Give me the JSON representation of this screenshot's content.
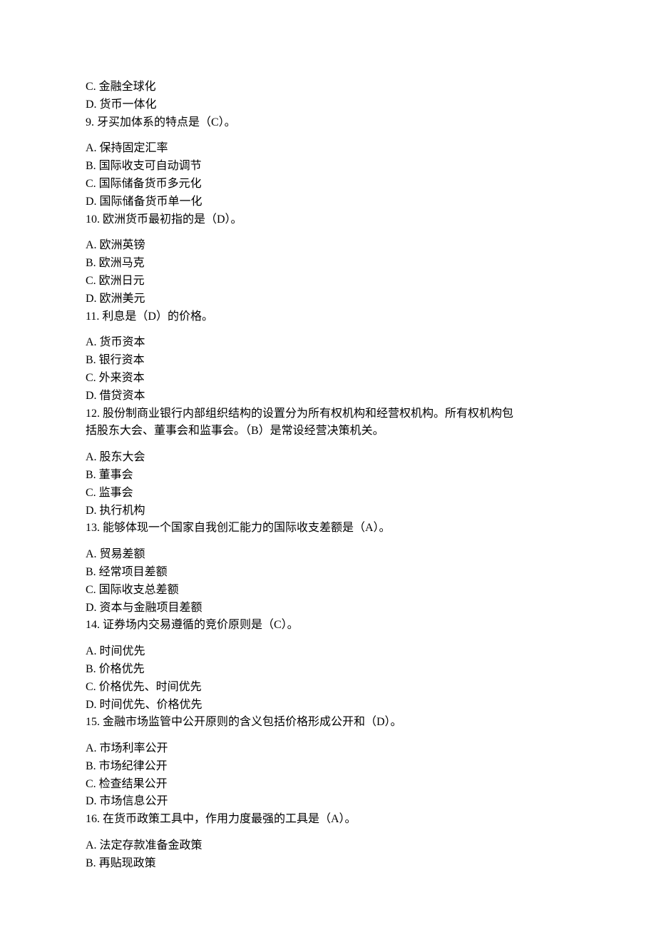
{
  "intro": {
    "optC": "C.  金融全球化",
    "optD": "D.  货币一体化"
  },
  "q9": {
    "stem": "9.      牙买加体系的特点是（C）。",
    "A": "A.  保持固定汇率",
    "B": "B.  国际收支可自动调节",
    "C": "C.  国际储备货币多元化",
    "D": "D.  国际储备货币单一化"
  },
  "q10": {
    "stem": "10.      欧洲货币最初指的是（D）。",
    "A": "A.  欧洲英镑",
    "B": "B.  欧洲马克",
    "C": "C.  欧洲日元",
    "D": "D.  欧洲美元"
  },
  "q11": {
    "stem": "11.      利息是（D）的价格。",
    "A": "A.  货币资本",
    "B": "B.  银行资本",
    "C": "C.  外来资本",
    "D": "D.  借贷资本"
  },
  "q12": {
    "stem1": "12.      股份制商业银行内部组织结构的设置分为所有权机构和经营权机构。所有权机构包",
    "stem2": "括股东大会、董事会和监事会。（B）是常设经营决策机关。",
    "A": "A.  股东大会",
    "B": "B.  董事会",
    "C": "C.  监事会",
    "D": "D.  执行机构"
  },
  "q13": {
    "stem": "13.      能够体现一个国家自我创汇能力的国际收支差额是（A）。",
    "A": "A.  贸易差额",
    "B": "B.  经常项目差额",
    "C": "C.  国际收支总差额",
    "D": "D.  资本与金融项目差额"
  },
  "q14": {
    "stem": "14.      证券场内交易遵循的竞价原则是（C）。",
    "A": "A.  时间优先",
    "B": "B.  价格优先",
    "C": "C.  价格优先、时间优先",
    "D": "D.  时间优先、价格优先"
  },
  "q15": {
    "stem": "15.      金融市场监管中公开原则的含义包括价格形成公开和（D）。",
    "A": "A.  市场利率公开",
    "B": "B.  市场纪律公开",
    "C": "C.  检查结果公开",
    "D": "D.  市场信息公开"
  },
  "q16": {
    "stem": "16.      在货币政策工具中，作用力度最强的工具是（A）。",
    "A": "A.  法定存款准备金政策",
    "B": "B.  再贴现政策"
  }
}
